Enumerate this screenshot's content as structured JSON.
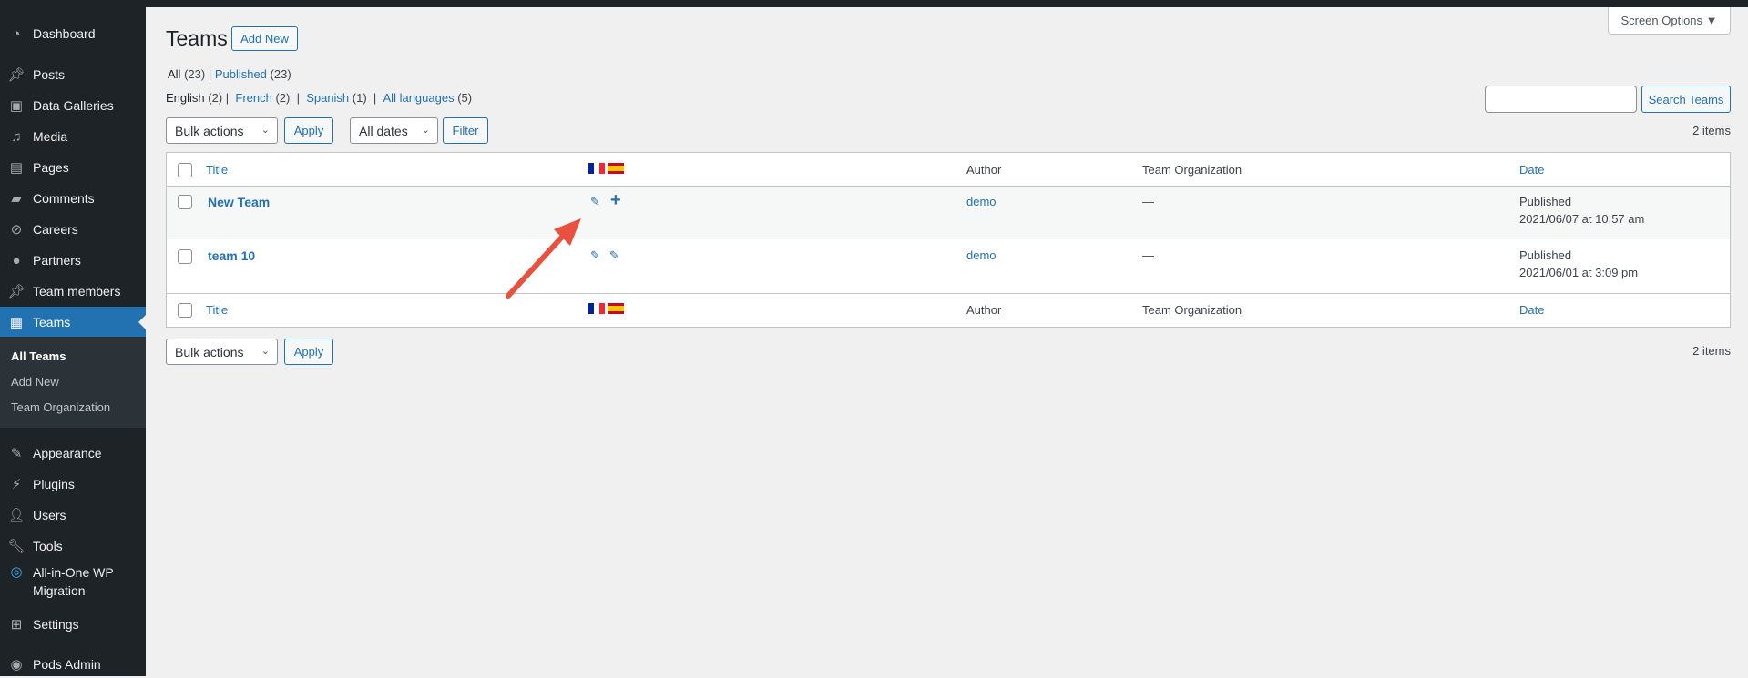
{
  "sidebar": {
    "items": [
      {
        "label": "Dashboard",
        "icon": "dashboard-icon"
      },
      {
        "label": "Posts",
        "icon": "pin-icon"
      },
      {
        "label": "Data Galleries",
        "icon": "gallery-icon"
      },
      {
        "label": "Media",
        "icon": "media-icon"
      },
      {
        "label": "Pages",
        "icon": "pages-icon"
      },
      {
        "label": "Comments",
        "icon": "comment-icon"
      },
      {
        "label": "Careers",
        "icon": "paperclip-icon"
      },
      {
        "label": "Partners",
        "icon": "groups-icon"
      },
      {
        "label": "Team members",
        "icon": "pin-icon"
      },
      {
        "label": "Teams",
        "icon": "id-card-icon"
      },
      {
        "label": "Appearance",
        "icon": "brush-icon"
      },
      {
        "label": "Plugins",
        "icon": "plug-icon"
      },
      {
        "label": "Users",
        "icon": "user-icon"
      },
      {
        "label": "Tools",
        "icon": "wrench-icon"
      },
      {
        "label": "All-in-One WP",
        "label2": "Migration",
        "icon": "migration-icon"
      },
      {
        "label": "Settings",
        "icon": "settings-icon"
      },
      {
        "label": "Pods Admin",
        "icon": "pods-icon"
      }
    ],
    "submenu": [
      "All Teams",
      "Add New",
      "Team Organization"
    ]
  },
  "header": {
    "title": "Teams",
    "add_new": "Add New",
    "screen_options": "Screen Options"
  },
  "status": {
    "all": "All",
    "all_count": "(23)",
    "published": "Published",
    "published_count": "(23)"
  },
  "languages": {
    "english": "English",
    "english_count": "(2)",
    "french": "French",
    "french_count": "(2)",
    "spanish": "Spanish",
    "spanish_count": "(1)",
    "all": "All languages",
    "all_count": "(5)"
  },
  "filters": {
    "bulk_actions": "Bulk actions",
    "apply": "Apply",
    "all_dates": "All dates",
    "filter": "Filter",
    "search_button": "Search Teams",
    "search_value": "",
    "items_count": "2 items"
  },
  "table": {
    "columns": {
      "title": "Title",
      "author": "Author",
      "org": "Team Organization",
      "date": "Date"
    },
    "rows": [
      {
        "title": "New Team",
        "author": "demo",
        "org": "—",
        "status": "Published",
        "date": "2021/06/07 at 10:57 am"
      },
      {
        "title": "team 10",
        "author": "demo",
        "org": "—",
        "status": "Published",
        "date": "2021/06/01 at 3:09 pm"
      }
    ]
  },
  "colors": {
    "accent": "#2271b1",
    "sidebar": "#1d2327",
    "arrow": "#e8513f"
  }
}
